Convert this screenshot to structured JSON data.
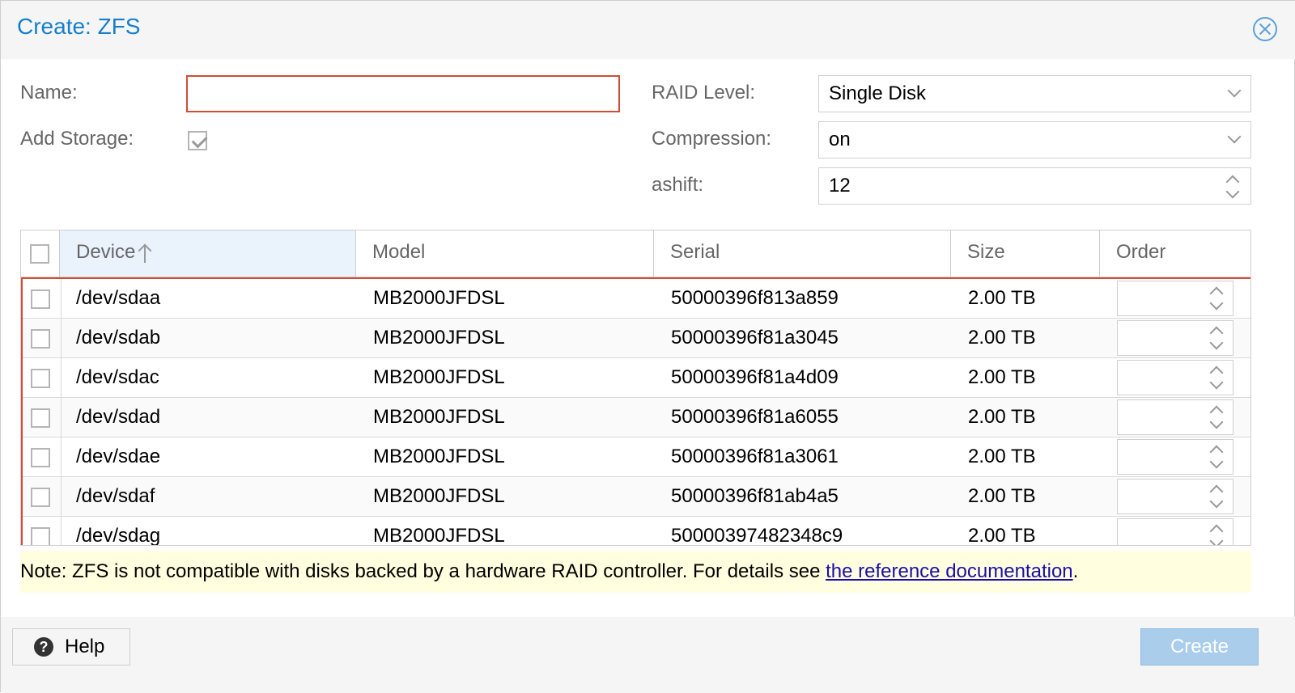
{
  "window": {
    "title": "Create: ZFS"
  },
  "form": {
    "name_label": "Name:",
    "name_value": "",
    "add_storage_label": "Add Storage:",
    "add_storage_checked": true,
    "raid_label": "RAID Level:",
    "raid_value": "Single Disk",
    "compression_label": "Compression:",
    "compression_value": "on",
    "ashift_label": "ashift:",
    "ashift_value": "12"
  },
  "grid": {
    "columns": {
      "device": "Device",
      "model": "Model",
      "serial": "Serial",
      "size": "Size",
      "order": "Order"
    },
    "sorted_by": "Device",
    "rows": [
      {
        "device": "/dev/sdaa",
        "model": "MB2000JFDSL",
        "serial": "50000396f813a859",
        "size": "2.00 TB",
        "order": ""
      },
      {
        "device": "/dev/sdab",
        "model": "MB2000JFDSL",
        "serial": "50000396f81a3045",
        "size": "2.00 TB",
        "order": ""
      },
      {
        "device": "/dev/sdac",
        "model": "MB2000JFDSL",
        "serial": "50000396f81a4d09",
        "size": "2.00 TB",
        "order": ""
      },
      {
        "device": "/dev/sdad",
        "model": "MB2000JFDSL",
        "serial": "50000396f81a6055",
        "size": "2.00 TB",
        "order": ""
      },
      {
        "device": "/dev/sdae",
        "model": "MB2000JFDSL",
        "serial": "50000396f81a3061",
        "size": "2.00 TB",
        "order": ""
      },
      {
        "device": "/dev/sdaf",
        "model": "MB2000JFDSL",
        "serial": "50000396f81ab4a5",
        "size": "2.00 TB",
        "order": ""
      },
      {
        "device": "/dev/sdag",
        "model": "MB2000JFDSL",
        "serial": "50000397482348c9",
        "size": "2.00 TB",
        "order": ""
      }
    ]
  },
  "note": {
    "text": "Note: ZFS is not compatible with disks backed by a hardware RAID controller. For details see ",
    "link_text": "the reference documentation",
    "suffix": "."
  },
  "footer": {
    "help_label": "Help",
    "create_label": "Create"
  },
  "colors": {
    "title": "#157fcc",
    "invalid_border": "#cf4c35",
    "note_bg": "#ffffe0",
    "create_disabled_bg": "#a9cdea"
  },
  "icons": {
    "close": "close-icon",
    "help": "help-icon",
    "sort_asc": "sort-ascending-icon",
    "dropdown": "chevron-down-icon",
    "spinner": "spinner-icon"
  }
}
